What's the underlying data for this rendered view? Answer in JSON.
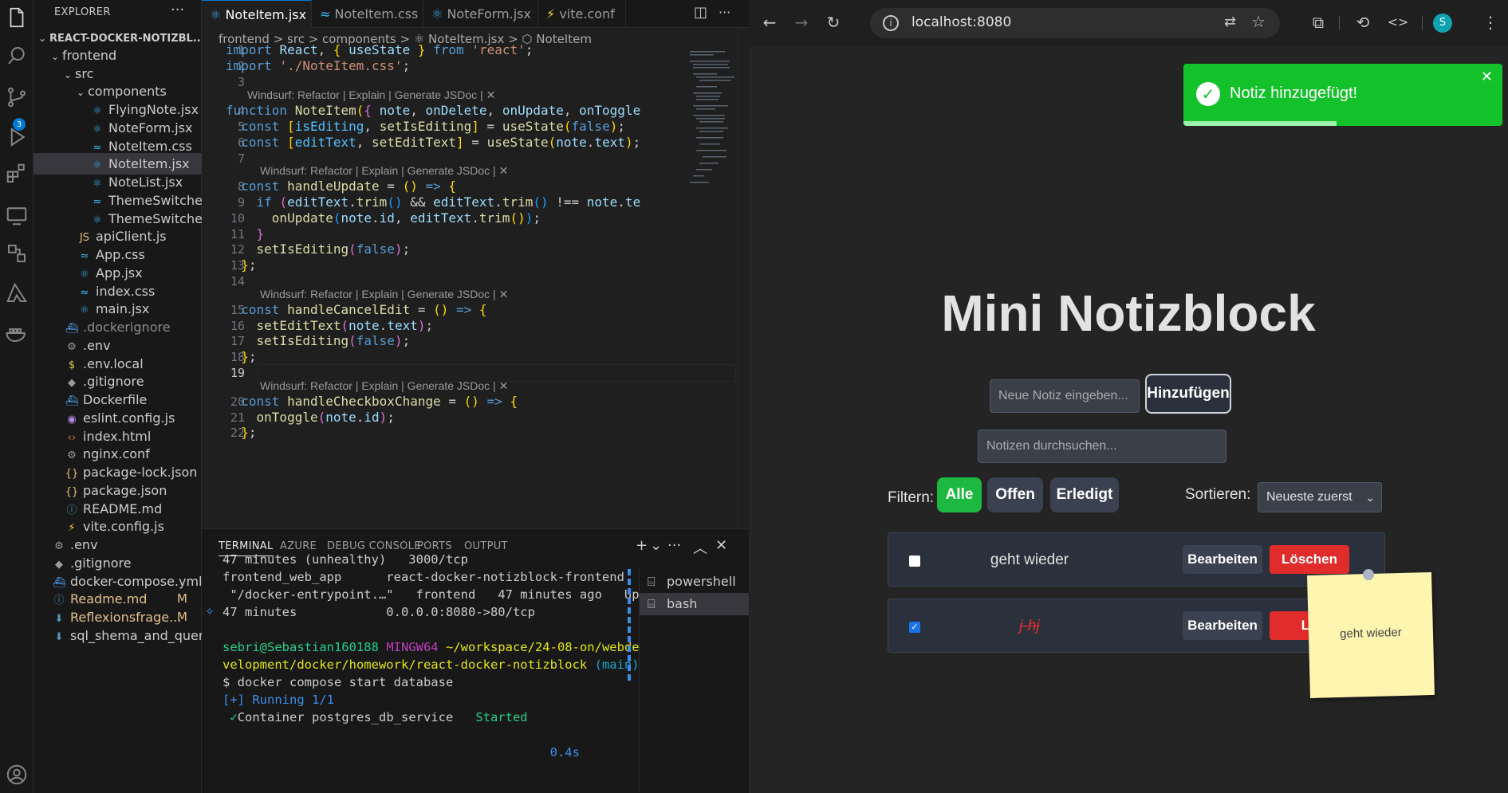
{
  "explorer": {
    "title": "EXPLORER",
    "more": "···",
    "items": [
      {
        "label": "REACT-DOCKER-NOTIZBL...",
        "icon": "chevron-down",
        "depth": 0,
        "bold": true
      },
      {
        "label": "frontend",
        "icon": "chevron-down",
        "depth": 1
      },
      {
        "label": "src",
        "icon": "chevron-down",
        "depth": 2
      },
      {
        "label": "components",
        "icon": "chevron-down",
        "depth": 3
      },
      {
        "label": "FlyingNote.jsx",
        "icon": "react",
        "depth": 4
      },
      {
        "label": "NoteForm.jsx",
        "icon": "react",
        "depth": 4
      },
      {
        "label": "NoteItem.css",
        "icon": "tailwind",
        "depth": 4
      },
      {
        "label": "NoteItem.jsx",
        "icon": "react",
        "depth": 4,
        "selected": true
      },
      {
        "label": "NoteList.jsx",
        "icon": "react",
        "depth": 4
      },
      {
        "label": "ThemeSwitcher.css",
        "icon": "tailwind",
        "depth": 4
      },
      {
        "label": "ThemeSwitcher.jsx",
        "icon": "react",
        "depth": 4
      },
      {
        "label": "apiClient.js",
        "icon": "js",
        "depth": 3
      },
      {
        "label": "App.css",
        "icon": "tailwind",
        "depth": 3
      },
      {
        "label": "App.jsx",
        "icon": "react",
        "depth": 3
      },
      {
        "label": "index.css",
        "icon": "tailwind",
        "depth": 3
      },
      {
        "label": "main.jsx",
        "icon": "react",
        "depth": 3
      },
      {
        "label": ".dockerignore",
        "icon": "docker",
        "depth": 2,
        "dim": true
      },
      {
        "label": ".env",
        "icon": "gear",
        "depth": 2
      },
      {
        "label": ".env.local",
        "icon": "dollar",
        "depth": 2
      },
      {
        "label": ".gitignore",
        "icon": "git",
        "depth": 2
      },
      {
        "label": "Dockerfile",
        "icon": "docker",
        "depth": 2
      },
      {
        "label": "eslint.config.js",
        "icon": "eslint",
        "depth": 2
      },
      {
        "label": "index.html",
        "icon": "html",
        "depth": 2
      },
      {
        "label": "nginx.conf",
        "icon": "gear",
        "depth": 2
      },
      {
        "label": "package-lock.json",
        "icon": "json",
        "depth": 2
      },
      {
        "label": "package.json",
        "icon": "json",
        "depth": 2
      },
      {
        "label": "README.md",
        "icon": "info",
        "depth": 2
      },
      {
        "label": "vite.config.js",
        "icon": "vite",
        "depth": 2
      },
      {
        "label": ".env",
        "icon": "gear",
        "depth": 1
      },
      {
        "label": ".gitignore",
        "icon": "git",
        "depth": 1
      },
      {
        "label": "docker-compose.yml",
        "icon": "docker",
        "depth": 1
      },
      {
        "label": "Readme.md",
        "icon": "info",
        "depth": 1,
        "status": "M",
        "modified": true
      },
      {
        "label": "Reflexionsfrage...",
        "icon": "download",
        "depth": 1,
        "status": "M",
        "modified": true
      },
      {
        "label": "sql_shema_and_queri...",
        "icon": "download",
        "depth": 1
      }
    ],
    "scm_badge": "3"
  },
  "editor": {
    "tabs": [
      {
        "label": "NoteItem.jsx",
        "icon": "react",
        "active": true,
        "close": "✕"
      },
      {
        "label": "NoteItem.css",
        "icon": "tailwind"
      },
      {
        "label": "NoteForm.jsx",
        "icon": "react"
      },
      {
        "label": "vite.conf",
        "icon": "vite"
      }
    ],
    "breadcrumb": "frontend > src > components > ⚛ NoteItem.jsx > ⬡ NoteItem",
    "lens": "Windsurf: Refactor | Explain | Generate JSDoc | ✕",
    "lines": [
      {
        "n": "1",
        "html": "<span class='kw'>import</span> <span class='vr'>React</span>, <span class='br1'>{</span> <span class='vr'>useState</span> <span class='br1'>}</span> <span class='kw'>from</span> <span class='st'>'react'</span>;"
      },
      {
        "n": "2",
        "html": "<span class='kw'>import</span> <span class='st'>'./NoteItem.css'</span>;"
      },
      {
        "n": "3",
        "html": ""
      },
      {
        "n": "4",
        "html": "<span class='kw'>function</span> <span class='fn'>NoteItem</span><span class='br1'>(</span><span class='br2'>{</span> <span class='vr'>note</span>, <span class='vr'>onDelete</span>, <span class='vr'>onUpdate</span>, <span class='vr'>onToggle</span>"
      },
      {
        "n": "5",
        "html": "  <span class='kw'>const</span> <span class='br1'>[</span><span class='ct'>isEditing</span>, <span class='fn'>setIsEditing</span><span class='br1'>]</span> = <span class='fn'>useState</span><span class='br1'>(</span><span class='kw'>false</span><span class='br1'>)</span>;"
      },
      {
        "n": "6",
        "html": "  <span class='kw'>const</span> <span class='br1'>[</span><span class='ct'>editText</span>, <span class='fn'>setEditText</span><span class='br1'>]</span> = <span class='fn'>useState</span><span class='br1'>(</span><span class='vr'>note</span>.<span class='vr'>text</span><span class='br1'>)</span>;"
      },
      {
        "n": "7",
        "html": ""
      },
      {
        "n": "8",
        "html": "  <span class='kw'>const</span> <span class='fn'>handleUpdate</span> = <span class='br1'>()</span> <span class='kw'>=&gt;</span> <span class='br1'>{</span>"
      },
      {
        "n": "9",
        "html": "    <span class='kw'>if</span> <span class='br2'>(</span><span class='vr'>editText</span>.<span class='fn'>trim</span><span class='br3'>()</span> &amp;&amp; <span class='vr'>editText</span>.<span class='fn'>trim</span><span class='br3'>()</span> !== <span class='vr'>note</span>.<span class='vr'>te</span>"
      },
      {
        "n": "10",
        "html": "      <span class='fn'>onUpdate</span><span class='br3'>(</span><span class='vr'>note</span>.<span class='vr'>id</span>, <span class='vr'>editText</span>.<span class='fn'>trim</span><span class='br1'>()</span><span class='br3'>)</span>;"
      },
      {
        "n": "11",
        "html": "    <span class='br2'>}</span>"
      },
      {
        "n": "12",
        "html": "    <span class='fn'>setIsEditing</span><span class='br2'>(</span><span class='kw'>false</span><span class='br2'>)</span>;"
      },
      {
        "n": "13",
        "html": "  <span class='br1'>}</span>;"
      },
      {
        "n": "14",
        "html": ""
      },
      {
        "n": "15",
        "html": "  <span class='kw'>const</span> <span class='fn'>handleCancelEdit</span> = <span class='br1'>()</span> <span class='kw'>=&gt;</span> <span class='br1'>{</span>"
      },
      {
        "n": "16",
        "html": "    <span class='fn'>setEditText</span><span class='br2'>(</span><span class='vr'>note</span>.<span class='vr'>text</span><span class='br2'>)</span>;"
      },
      {
        "n": "17",
        "html": "    <span class='fn'>setIsEditing</span><span class='br2'>(</span><span class='kw'>false</span><span class='br2'>)</span>;"
      },
      {
        "n": "18",
        "html": "  <span class='br1'>}</span>;"
      },
      {
        "n": "19",
        "html": ""
      },
      {
        "n": "20",
        "html": "  <span class='kw'>const</span> <span class='fn'>handleCheckboxChange</span> = <span class='br1'>()</span> <span class='kw'>=&gt;</span> <span class='br1'>{</span>"
      },
      {
        "n": "21",
        "html": "    <span class='fn'>onToggle</span><span class='br2'>(</span><span class='vr'>note</span>.<span class='vr'>id</span><span class='br2'>)</span>;"
      },
      {
        "n": "22",
        "html": "  <span class='br1'>}</span>;"
      }
    ]
  },
  "panel": {
    "tabs": [
      "TERMINAL",
      "AZURE",
      "DEBUG CONSOLE",
      "PORTS",
      "OUTPUT"
    ],
    "actions": [
      "+",
      "⌄",
      "···",
      "︿",
      "✕"
    ],
    "lines": [
      "47 minutes (unhealthy)   3000/tcp",
      "frontend_web_app      react-docker-notizblock-frontend",
      " \"/docker-entrypoint.…\"   frontend   47 minutes ago   Up",
      "47 minutes            0.0.0.0:8080->80/tcp",
      "",
      "<span class='tg'>sebri@Sebastian160188</span> <span class='tm'>MINGW64</span> <span class='ty'>~/workspace/24-08-on/webde</span>",
      "<span class='ty'>velopment/docker/homework/react-docker-notizblock</span> <span class='tc'>(main)</span>",
      "$ docker compose start database",
      "<span class='tb'>[+] Running 1/1</span>",
      " <span class='tg'>✓</span>Container postgres_db_service   <span class='tg'>Started</span>",
      "",
      "                                            <span class='tb'>0.4s</span>"
    ],
    "sessions": [
      {
        "label": "powershell"
      },
      {
        "label": "bash",
        "selected": true
      }
    ]
  },
  "browser": {
    "url": "localhost:8080",
    "profile_initial": "S",
    "toast": {
      "text": "Notiz hinzugefügt!",
      "close": "✕",
      "progress": 0.48
    },
    "app": {
      "title": "Mini Notizblock",
      "new_note_placeholder": "Neue Notiz eingeben...",
      "add_button": "Hinzufügen",
      "search_placeholder": "Notizen durchsuchen...",
      "filter_label": "Filtern:",
      "filters": [
        {
          "label": "Alle",
          "active": true
        },
        {
          "label": "Offen"
        },
        {
          "label": "Erledigt"
        }
      ],
      "sort_label": "Sortieren:",
      "sort_value": "Neueste zuerst",
      "notes": [
        {
          "text": "geht wieder",
          "done": false,
          "edit": "Bearbeiten",
          "delete": "Löschen"
        },
        {
          "text": "j-hj",
          "done": true,
          "edit": "Bearbeiten",
          "delete": "Lö"
        }
      ],
      "flying_note": "geht wieder"
    },
    "colors": {
      "green": "#1db83f",
      "red": "#e12c2c",
      "toast": "#13c12b"
    }
  }
}
